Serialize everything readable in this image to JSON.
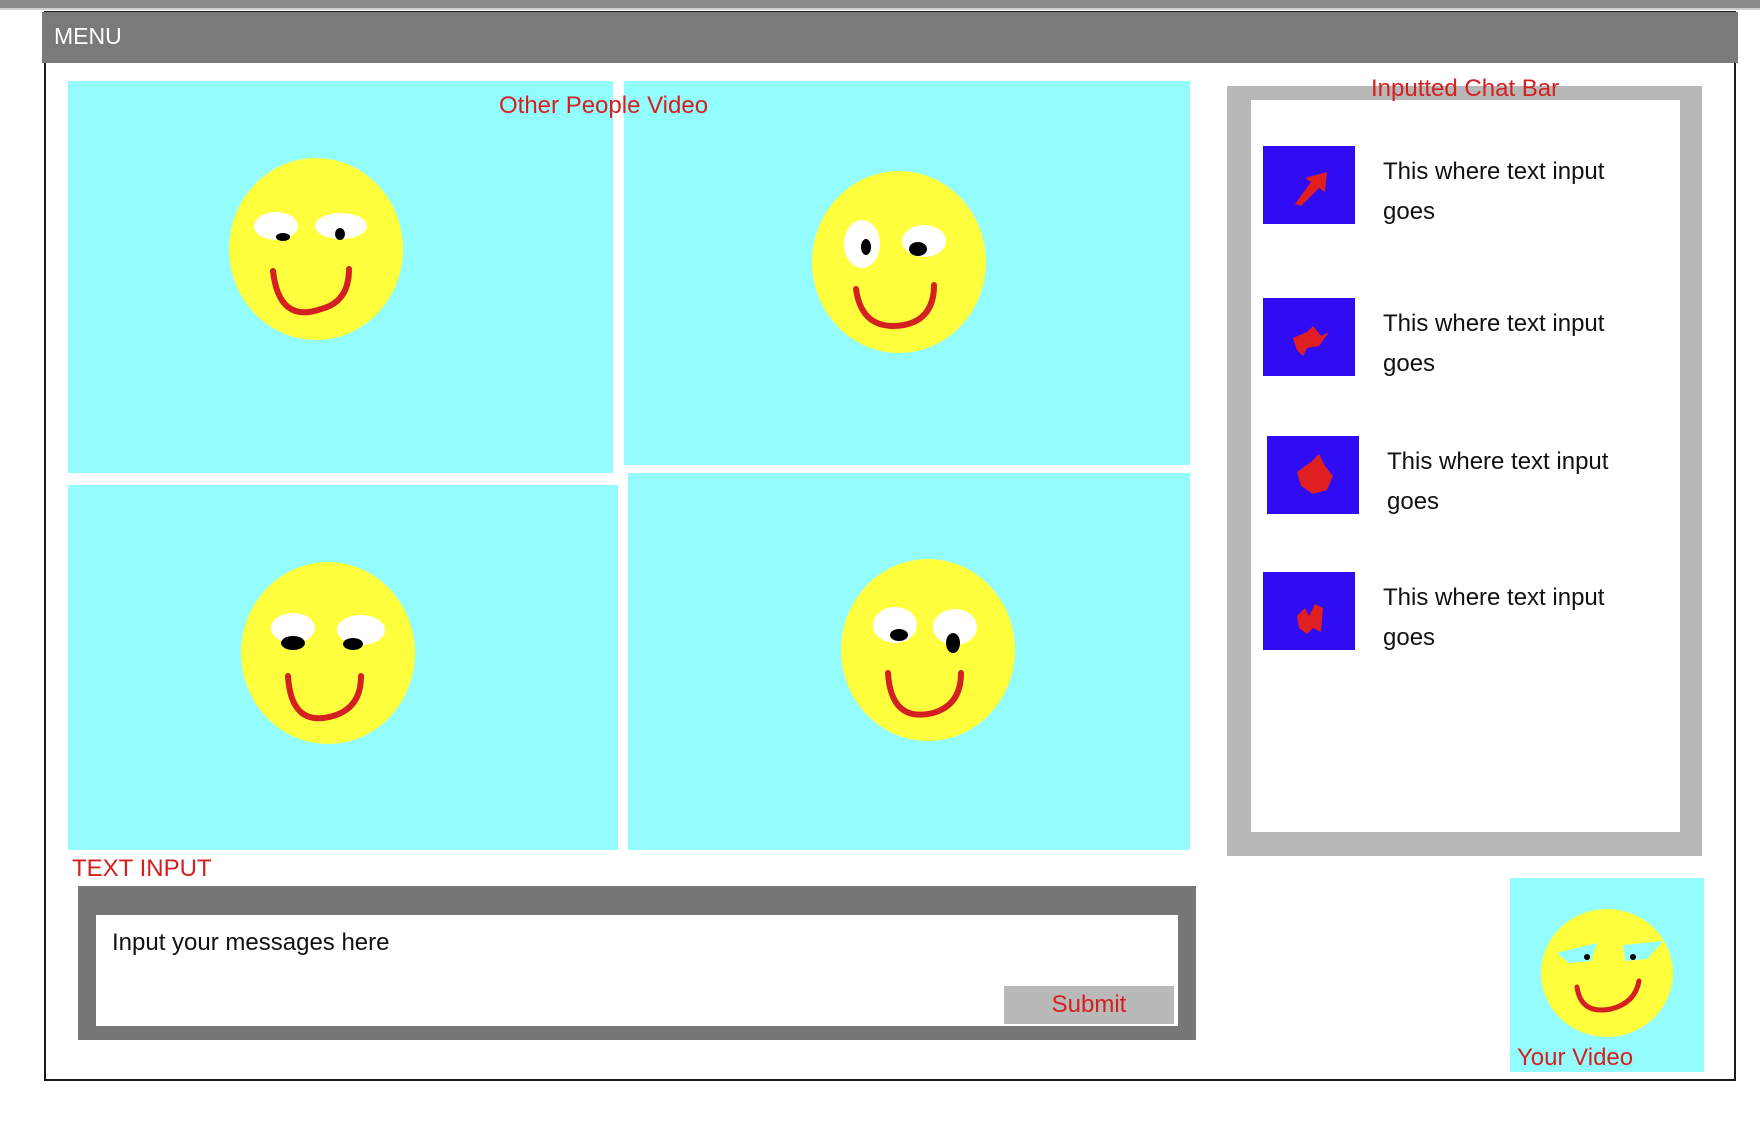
{
  "menu": {
    "label": "MENU"
  },
  "video_grid": {
    "label": "Other People Video"
  },
  "chat": {
    "label": "Inputted Chat Bar",
    "messages": [
      {
        "text_line1": "This where text input",
        "text_line2": "goes"
      },
      {
        "text_line1": "This where text input",
        "text_line2": "goes"
      },
      {
        "text_line1": "This where text input",
        "text_line2": "goes"
      },
      {
        "text_line1": "This where text input",
        "text_line2": "goes"
      }
    ]
  },
  "text_input": {
    "label": "TEXT INPUT",
    "placeholder": "Input your messages here",
    "submit_label": "Submit"
  },
  "own_video": {
    "label": "Your Video"
  },
  "colors": {
    "menu_bar": "#7a7a7a",
    "video_tile": "#93fdfd",
    "face": "#ffff3d",
    "smile": "#d42020",
    "label_red": "#d42020",
    "avatar": "#2f0cf4",
    "chat_border": "#b7b7b7"
  }
}
